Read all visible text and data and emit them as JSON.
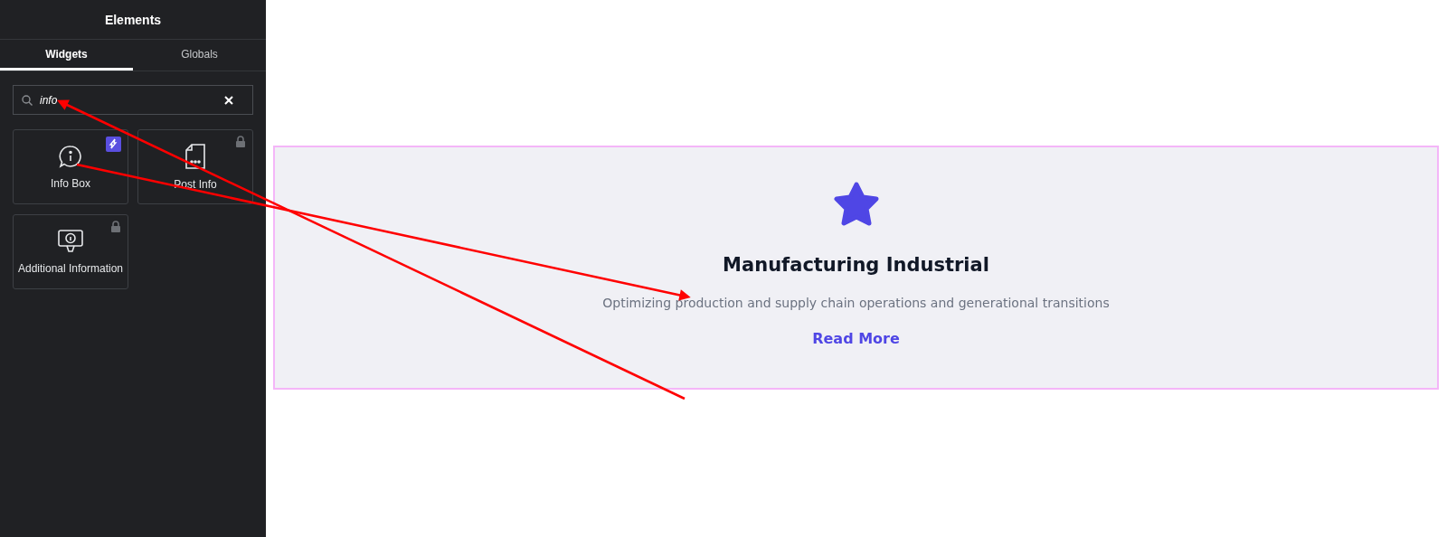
{
  "panel": {
    "title": "Elements"
  },
  "tabs": [
    {
      "label": "Widgets",
      "selected": true
    },
    {
      "label": "Globals",
      "selected": false
    }
  ],
  "search": {
    "value": "info"
  },
  "widgets": [
    {
      "label": "Info Box",
      "kind": "info-bubble",
      "locked": false,
      "pro_badge": true
    },
    {
      "label": "Post Info",
      "kind": "document",
      "locked": true,
      "pro_badge": false
    },
    {
      "label": "Additional Information",
      "kind": "info-screen",
      "locked": true,
      "pro_badge": false
    }
  ],
  "info_box": {
    "title": "Manufacturing Industrial",
    "description": "Optimizing production and supply chain operations and generational transitions",
    "link": "Read More"
  }
}
